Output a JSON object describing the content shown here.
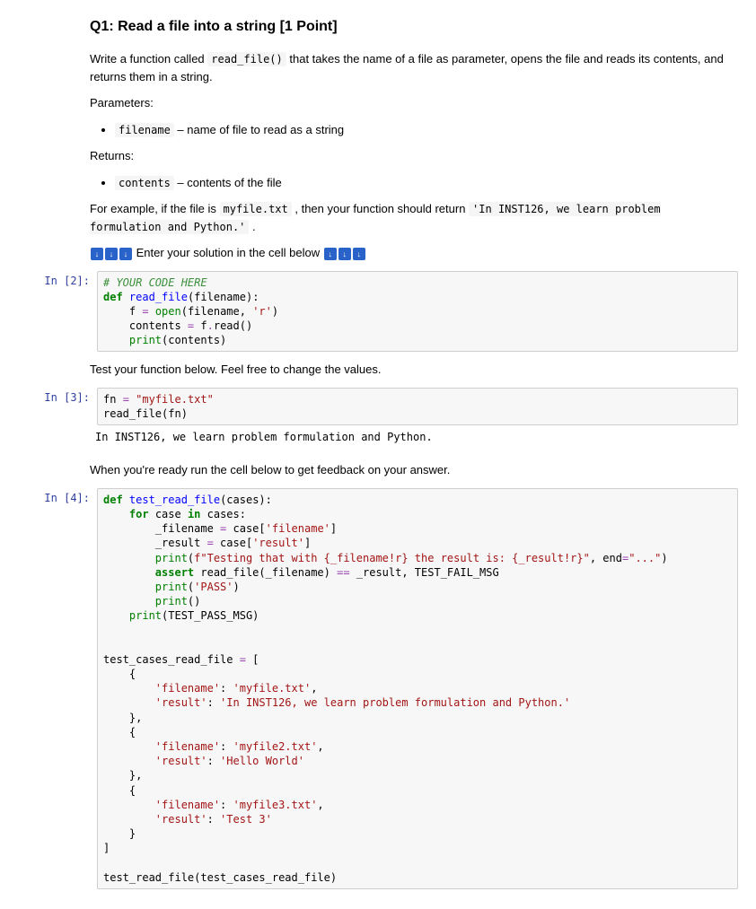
{
  "question": {
    "title": "Q1: Read a file into a string [1 Point]",
    "intro_pre": "Write a function called ",
    "intro_code": "read_file()",
    "intro_post": " that takes the name of a file as parameter, opens the file and reads its contents, and returns them in a string.",
    "params_label": "Parameters:",
    "param1_code": "filename",
    "param1_desc": " – name of file to read as a string",
    "returns_label": "Returns:",
    "return1_code": "contents",
    "return1_desc": " – contents of the file",
    "example_pre": "For example, if the file is ",
    "example_file": "myfile.txt",
    "example_mid": " , then your function should return ",
    "example_result": "'In INST126, we learn problem formulation and Python.'",
    "example_post": " .",
    "enter_solution": " Enter your solution in the cell below ",
    "test_below": "Test your function below. Feel free to change the values.",
    "ready_text": "When you're ready run the cell below to get feedback on your answer."
  },
  "cells": {
    "c1": {
      "prompt": "In [2]:"
    },
    "c2": {
      "prompt": "In [3]:"
    },
    "c3": {
      "prompt": "In [4]:"
    }
  },
  "code": {
    "c1_comment": "# YOUR CODE HERE",
    "c1_def": "def",
    "c1_fname": "read_file",
    "c1_params": "(filename):",
    "c1_l2a": "    f ",
    "c1_eq": "=",
    "c1_open": " open",
    "c1_l2b": "(filename, ",
    "c1_r": "'r'",
    "c1_l2c": ")",
    "c1_l3a": "    contents ",
    "c1_l3b": " f",
    "c1_dot": ".",
    "c1_read": "read",
    "c1_l3c": "()",
    "c1_l4a": "    ",
    "c1_print": "print",
    "c1_l4b": "(contents)",
    "c2_l1a": "fn ",
    "c2_str": "\"myfile.txt\"",
    "c2_l2": "read_file(fn)",
    "c2_out": "In INST126, we learn problem formulation and Python.",
    "c3_def": "def",
    "c3_fname": "test_read_file",
    "c3_params": "(cases):",
    "c3_for": "for",
    "c3_in": "in",
    "c3_l2a": "    ",
    "c3_l2b": " case ",
    "c3_l2c": " cases:",
    "c3_l3a": "        _filename ",
    "c3_l3b": " case[",
    "c3_fkey": "'filename'",
    "c3_l3c": "]",
    "c3_l4a": "        _result ",
    "c3_rkey": "'result'",
    "c3_l5a": "        ",
    "c3_fstr": "f\"Testing that with {_filename!r} the result is: {_result!r}\"",
    "c3_l5b": ", end",
    "c3_dots": "\"...\"",
    "c3_l5c": ")",
    "c3_assert": "assert",
    "c3_l6a": "        ",
    "c3_l6b": " read_file(_filename) ",
    "c3_eqeq": "==",
    "c3_l6c": " _result, TEST_FAIL_MSG",
    "c3_pass": "'PASS'",
    "c3_l7a": "        ",
    "c3_l7b": "(",
    "c3_l7c": ")",
    "c3_l8a": "        ",
    "c3_l8b": "()",
    "c3_l9a": "    ",
    "c3_l9b": "(TEST_PASS_MSG)",
    "c3_blank": "",
    "c3_tca": "test_cases_read_file ",
    "c3_tcb": " [",
    "c3_open_brace": "    {",
    "c3_close_brace_comma": "    },",
    "c3_close_brace": "    }",
    "c3_close_bracket": "]",
    "c3_r1f": "'myfile.txt'",
    "c3_r1r": "'In INST126, we learn problem formulation and Python.'",
    "c3_r2f": "'myfile2.txt'",
    "c3_r2r": "'Hello World'",
    "c3_r3f": "'myfile3.txt'",
    "c3_r3r": "'Test 3'",
    "c3_kv_f": "        ",
    "c3_kv_colon": ": ",
    "c3_kv_comma": ",",
    "c3_last": "test_read_file(test_cases_read_file)"
  }
}
